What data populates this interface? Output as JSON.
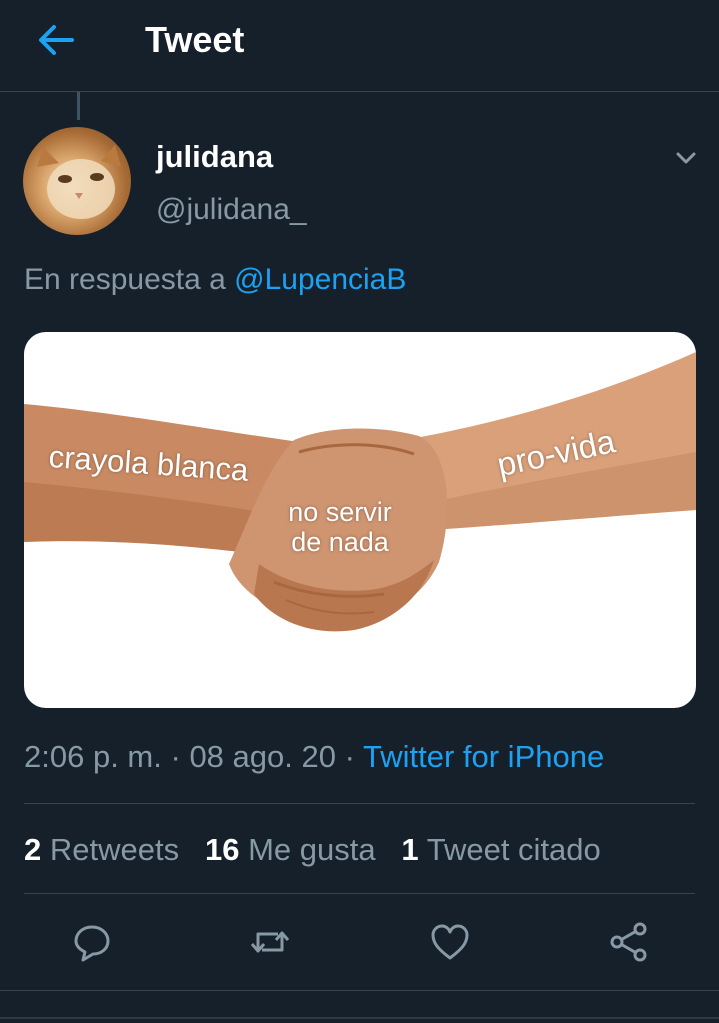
{
  "header": {
    "title": "Tweet",
    "back_icon": "arrow-left-icon",
    "accent_color": "#1da1f2"
  },
  "tweet": {
    "author": {
      "name": "julidana",
      "handle": "@julidana_",
      "avatar_icon": "cat-avatar"
    },
    "reply": {
      "prefix": "En respuesta a",
      "mention": "@LupenciaB"
    },
    "media": {
      "left_label": "crayola blanca",
      "middle_label": "no servir de nada",
      "right_label": "pro-vida"
    },
    "meta": {
      "time": "2:06 p. m.",
      "separator": "·",
      "date": "08 ago. 20",
      "source": "Twitter for iPhone"
    },
    "stats": {
      "retweets_count": "2",
      "retweets_label": "Retweets",
      "likes_count": "16",
      "likes_label": "Me gusta",
      "quotes_count": "1",
      "quotes_label": "Tweet citado"
    },
    "actions": [
      "reply-icon",
      "retweet-icon",
      "like-icon",
      "share-icon"
    ]
  },
  "colors": {
    "background": "#15202b",
    "secondary_text": "#8899a6",
    "divider": "#38444d"
  }
}
